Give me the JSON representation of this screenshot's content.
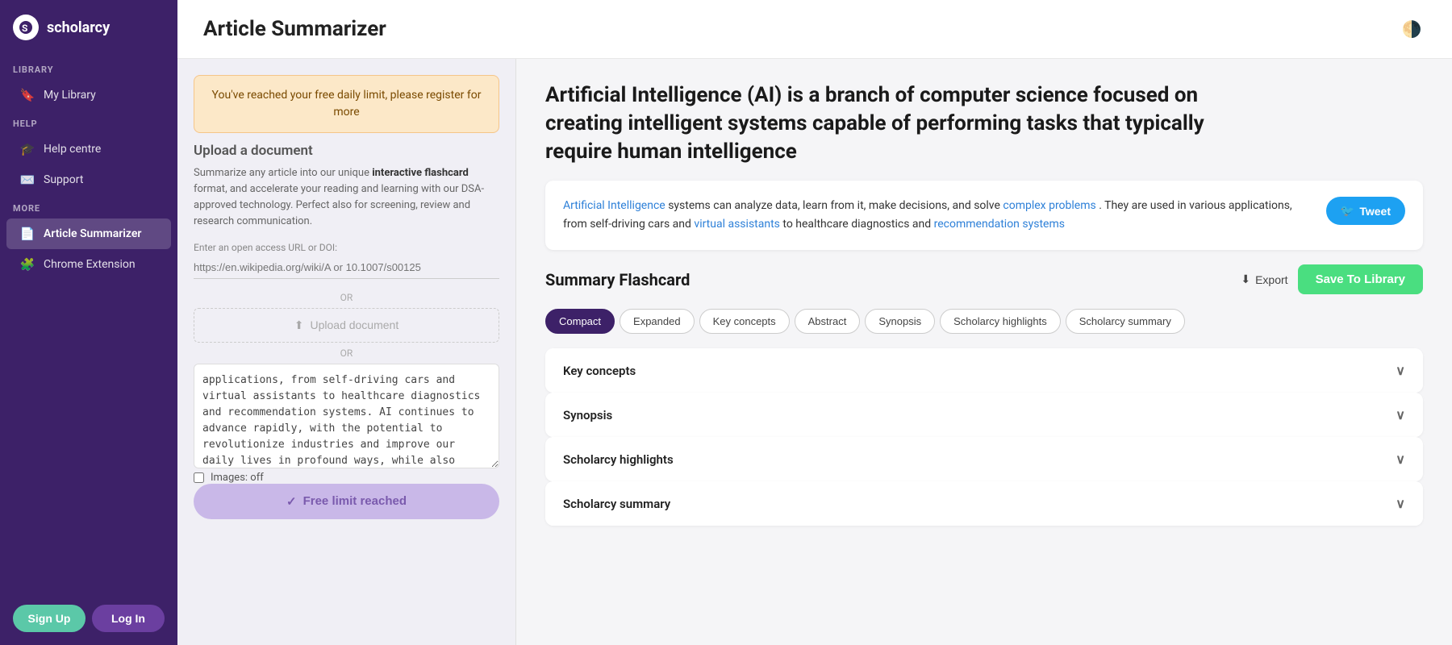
{
  "app": {
    "name": "scholarcy",
    "logo_text": "scholarcy"
  },
  "sidebar": {
    "library_label": "LIBRARY",
    "my_library_label": "My Library",
    "help_label": "HELP",
    "help_centre_label": "Help centre",
    "support_label": "Support",
    "more_label": "MORE",
    "article_summarizer_label": "Article Summarizer",
    "chrome_extension_label": "Chrome Extension",
    "signup_label": "Sign Up",
    "login_label": "Log In"
  },
  "header": {
    "title": "Article Summarizer"
  },
  "left_panel": {
    "alert_text": "You've reached your free daily limit, please register for more",
    "upload_title": "Upload a document",
    "upload_description_plain": "Summarize any article into our unique ",
    "upload_description_bold": "interactive flashcard",
    "upload_description_rest": " format, and accelerate your reading and learning with our DSA-approved technology. Perfect also for screening, review and research communication.",
    "url_label": "Enter an open access URL or DOI:",
    "url_placeholder": "https://en.wikipedia.org/wiki/A or 10.1007/s00125",
    "or_text": "OR",
    "upload_doc_label": "Upload document",
    "textarea_content": "applications, from self-driving cars and virtual assistants to healthcare diagnostics and recommendation systems. AI continues to advance rapidly, with the potential to revolutionize industries and improve our daily lives in profound ways, while also raising ethical and societal questions.",
    "images_label": "Images: off",
    "free_limit_label": "Free limit reached"
  },
  "right_panel": {
    "article_title": "Artificial Intelligence (AI) is a branch of computer science focused on creating intelligent systems capable of performing tasks that typically require human intelligence",
    "summary_text_1": " systems can analyze data, learn from it, make decisions, and solve ",
    "summary_link_1": "Artificial Intelligence",
    "summary_link_2": "complex problems",
    "summary_text_2": ". They are used in various applications, from self-driving cars and ",
    "summary_link_3": "virtual assistants",
    "summary_text_3": " to healthcare diagnostics and ",
    "summary_link_4": "recommendation systems",
    "tweet_label": "Tweet",
    "flashcard_title": "Summary Flashcard",
    "export_label": "Export",
    "save_library_label": "Save To Library",
    "tabs": [
      {
        "id": "compact",
        "label": "Compact",
        "active": true
      },
      {
        "id": "expanded",
        "label": "Expanded",
        "active": false
      },
      {
        "id": "key-concepts",
        "label": "Key concepts",
        "active": false
      },
      {
        "id": "abstract",
        "label": "Abstract",
        "active": false
      },
      {
        "id": "synopsis",
        "label": "Synopsis",
        "active": false
      },
      {
        "id": "scholarcy-highlights",
        "label": "Scholarcy highlights",
        "active": false
      },
      {
        "id": "scholarcy-summary",
        "label": "Scholarcy summary",
        "active": false
      }
    ],
    "accordions": [
      {
        "id": "key-concepts",
        "label": "Key concepts"
      },
      {
        "id": "synopsis",
        "label": "Synopsis"
      },
      {
        "id": "scholarcy-highlights",
        "label": "Scholarcy highlights"
      },
      {
        "id": "scholarcy-summary",
        "label": "Scholarcy summary"
      }
    ]
  },
  "icons": {
    "bookmark": "🔖",
    "graduation": "🎓",
    "envelope": "✉️",
    "article": "📄",
    "puzzle": "🧩",
    "upload": "⬆",
    "check": "✓",
    "chevron_down": "∨",
    "twitter": "🐦",
    "download": "⬇",
    "moon_sun": "🌗"
  }
}
